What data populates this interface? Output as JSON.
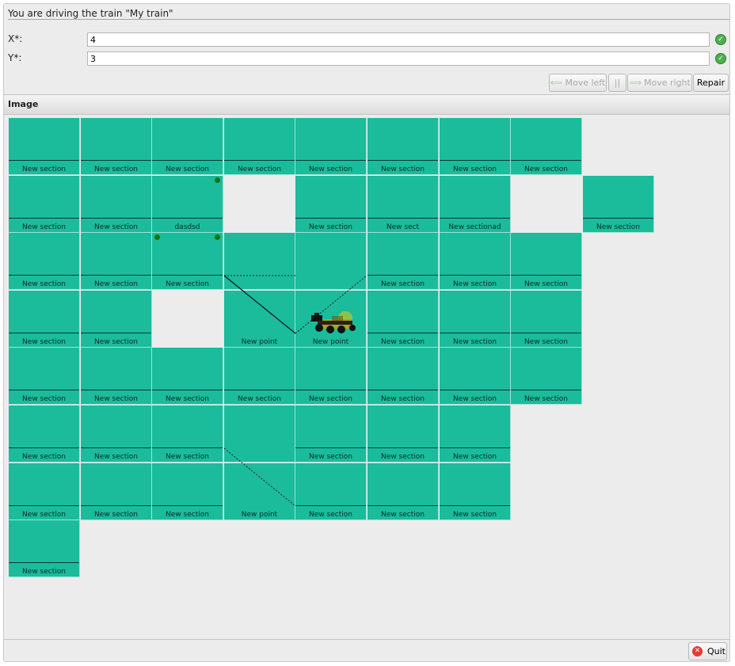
{
  "window": {
    "title": "You are driving the train \"My train\""
  },
  "form": {
    "x": {
      "label": "X*:",
      "value": "4",
      "status_icon": "check-icon"
    },
    "y": {
      "label": "Y*:",
      "value": "3",
      "status_icon": "check-icon"
    }
  },
  "toolbar": {
    "move_left": "Move left",
    "pause": "||",
    "move_right": "Move right",
    "repair": "Repair"
  },
  "panel": {
    "title": "Image"
  },
  "grid": {
    "rows": [
      [
        {
          "c": 0,
          "label": "New section"
        },
        {
          "c": 1,
          "label": "New section"
        },
        {
          "c": 2,
          "label": "New section"
        },
        {
          "c": 3,
          "label": "New section"
        },
        {
          "c": 4,
          "label": "New section"
        },
        {
          "c": 5,
          "label": "New section"
        },
        {
          "c": 6,
          "label": "New section"
        },
        {
          "c": 7,
          "label": "New section"
        }
      ],
      [
        {
          "c": 0,
          "label": "New section"
        },
        {
          "c": 1,
          "label": "New section"
        },
        {
          "c": 2,
          "label": "dasdsd",
          "dots": [
            "r"
          ]
        },
        {
          "c": 4,
          "label": "New section"
        },
        {
          "c": 5,
          "label": "New sect"
        },
        {
          "c": 6,
          "label": "New sectionad"
        },
        {
          "c": 8,
          "label": "New section"
        }
      ],
      [
        {
          "c": 0,
          "label": "New section"
        },
        {
          "c": 1,
          "label": "New section"
        },
        {
          "c": 2,
          "label": "New section",
          "dots": [
            "l",
            "r"
          ]
        },
        {
          "c": 3,
          "label": "",
          "nobar": true
        },
        {
          "c": 4,
          "label": "",
          "nobar": true
        },
        {
          "c": 5,
          "label": "New section"
        },
        {
          "c": 6,
          "label": "New section"
        },
        {
          "c": 7,
          "label": "New section"
        }
      ],
      [
        {
          "c": 0,
          "label": "New section"
        },
        {
          "c": 1,
          "label": "New section"
        },
        {
          "c": 3,
          "label": "New point",
          "nobar": true
        },
        {
          "c": 4,
          "label": "New point",
          "nobar": true
        },
        {
          "c": 5,
          "label": "New section"
        },
        {
          "c": 6,
          "label": "New section"
        },
        {
          "c": 7,
          "label": "New section"
        }
      ],
      [
        {
          "c": 0,
          "label": "New section"
        },
        {
          "c": 1,
          "label": "New section"
        },
        {
          "c": 2,
          "label": "New section"
        },
        {
          "c": 3,
          "label": "New section"
        },
        {
          "c": 4,
          "label": "New section"
        },
        {
          "c": 5,
          "label": "New section"
        },
        {
          "c": 6,
          "label": "New section"
        },
        {
          "c": 7,
          "label": "New section"
        }
      ],
      [
        {
          "c": 0,
          "label": "New section"
        },
        {
          "c": 1,
          "label": "New section"
        },
        {
          "c": 2,
          "label": "New section"
        },
        {
          "c": 3,
          "label": "",
          "nobar": true
        },
        {
          "c": 4,
          "label": "New section"
        },
        {
          "c": 5,
          "label": "New section"
        },
        {
          "c": 6,
          "label": "New section"
        }
      ],
      [
        {
          "c": 0,
          "label": "New section"
        },
        {
          "c": 1,
          "label": "New section"
        },
        {
          "c": 2,
          "label": "New section"
        },
        {
          "c": 3,
          "label": "New point",
          "nobar": true
        },
        {
          "c": 4,
          "label": "New section"
        },
        {
          "c": 5,
          "label": "New section"
        },
        {
          "c": 6,
          "label": "New section"
        }
      ],
      [
        {
          "c": 0,
          "label": "New section"
        }
      ]
    ],
    "train": {
      "col": 4,
      "row": 3,
      "icon": "train-icon"
    }
  },
  "footer": {
    "quit": "Quit"
  },
  "colors": {
    "track": "#1abc9c",
    "background": "#ececec",
    "dot": "#17720f"
  }
}
